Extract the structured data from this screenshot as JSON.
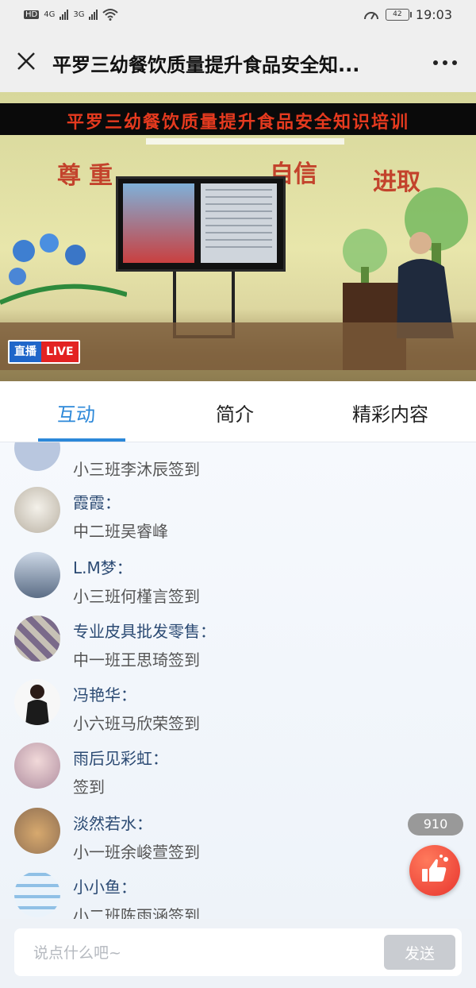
{
  "status_bar": {
    "network_left": "HD",
    "net_1": "4G",
    "net_2": "3G",
    "battery": "42",
    "time": "19:03"
  },
  "header": {
    "title": "平罗三幼餐饮质量提升食品安全知...",
    "close_icon": "close-icon",
    "more_icon": "more-dots-icon"
  },
  "video": {
    "banner": "平罗三幼餐饮质量提升食品安全知识培训",
    "wall_words": [
      "尊",
      "重",
      "自信",
      "进取"
    ],
    "live_zh": "直播",
    "live_en": "LIVE"
  },
  "tabs": [
    {
      "label": "互动",
      "active": true
    },
    {
      "label": "简介",
      "active": false
    },
    {
      "label": "精彩内容",
      "active": false
    }
  ],
  "messages": [
    {
      "name": "",
      "text": "小三班李沐辰签到",
      "avatar_color": "#b9c7df"
    },
    {
      "name": "霞霞：",
      "text": "中二班吴睿峰",
      "avatar_color": "#e7e2d8"
    },
    {
      "name": "L.M梦：",
      "text": "小三班何槿言签到",
      "avatar_color": "#c9d4e3"
    },
    {
      "name": "专业皮具批发零售：",
      "text": "中一班王思琦签到",
      "avatar_color": "#7a6a8a"
    },
    {
      "name": "冯艳华：",
      "text": "小六班马欣荣签到",
      "avatar_color": "#f2f2f2"
    },
    {
      "name": "雨后见彩虹：",
      "text": "签到",
      "avatar_color": "#d7c2c8"
    },
    {
      "name": "淡然若水：",
      "text": "小一班余峻萱签到",
      "avatar_color": "#c7b29d"
    },
    {
      "name": "小小鱼：",
      "text": "小二班陈雨涵签到",
      "avatar_color": "#cde2f2"
    }
  ],
  "like": {
    "count": "910",
    "icon": "thumbs-up-icon"
  },
  "input": {
    "placeholder": "说点什么吧~",
    "value": "",
    "send_label": "发送"
  }
}
